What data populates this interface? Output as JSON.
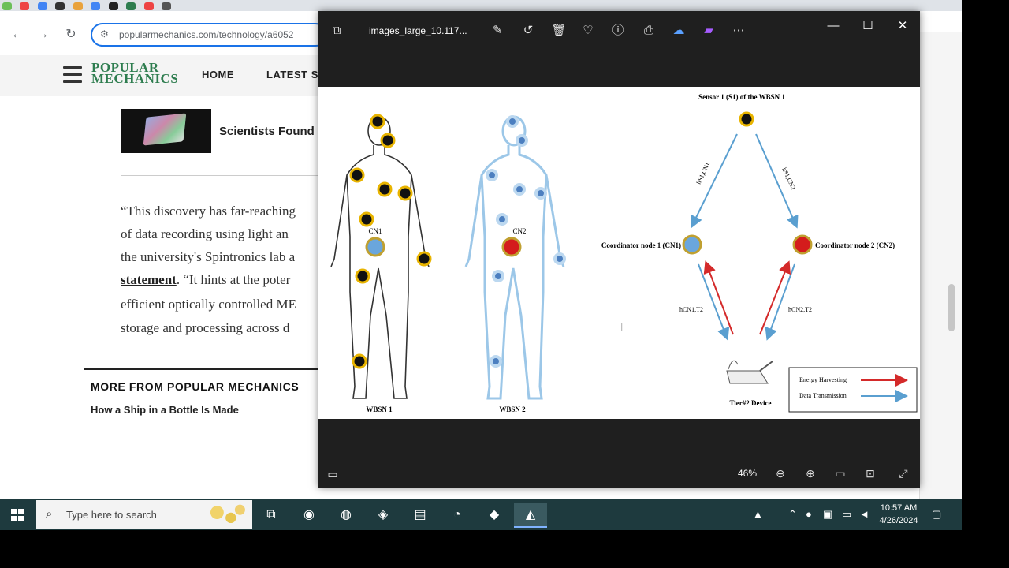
{
  "browser": {
    "url": "popularmechanics.com/technology/a6052"
  },
  "site": {
    "logo_line1": "POPULAR",
    "logo_line2": "MECHANICS",
    "nav": [
      "HOME",
      "LATEST ST"
    ]
  },
  "article": {
    "related_title": "Scientists Found",
    "paragraph_lines": [
      "“This discovery has far-reaching",
      "of data recording using light an",
      "the university's Spintronics lab a",
      "“It hints at the poter",
      "efficient optically controlled ME",
      "storage and processing across d"
    ],
    "link_text": "statement",
    "more_heading": "MORE FROM POPULAR MECHANICS",
    "more_link": "How a Ship in a Bottle Is Made"
  },
  "viewer": {
    "filename": "images_large_10.117...",
    "zoom": "46%",
    "figure": {
      "wbsn1_label": "WBSN 1",
      "wbsn2_label": "WBSN 2",
      "cn1": "CN1",
      "cn2": "CN2",
      "sensor_label": "Sensor 1 (S1) of the WBSN 1",
      "coord1": "Coordinator node 1 (CN1)",
      "coord2": "Coordinator node 2 (CN2)",
      "h_s1cn1": "hS1,CN1",
      "h_s1cn2": "hS1,CN2",
      "h_cn1t2": "hCN1,T2",
      "h_cn2t2": "hCN2,T2",
      "device": "Tier#2 Device",
      "legend_energy": "Energy Harvesting",
      "legend_data": "Data Transmission",
      "colors": {
        "energy": "#d42a2a",
        "data": "#5a9fd0",
        "sensor": "#e8b400",
        "cn1": "#6aa6dc",
        "cn2": "#d41c1c"
      }
    }
  },
  "taskbar": {
    "search_placeholder": "Type here to search",
    "time": "10:57 AM",
    "date": "4/26/2024"
  }
}
